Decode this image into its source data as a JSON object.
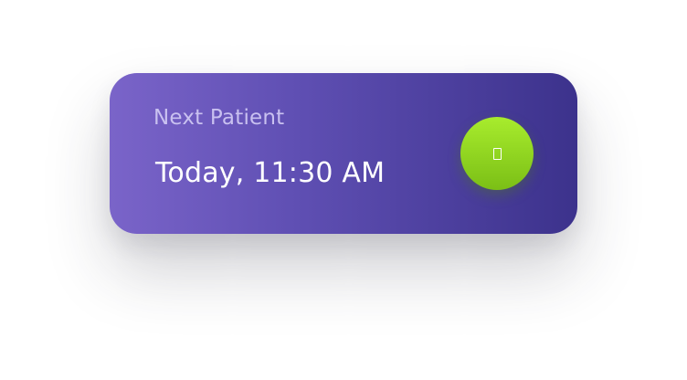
{
  "card": {
    "label": "Next Patient",
    "time": "Today, 11:30 AM",
    "action_icon": "phone-icon"
  },
  "colors": {
    "card_gradient_start": "#7a64c9",
    "card_gradient_end": "#3c328c",
    "label_text": "#c9c1f0",
    "time_text": "#ffffff",
    "action_start": "#a8ec2d",
    "action_end": "#7bbf16"
  }
}
